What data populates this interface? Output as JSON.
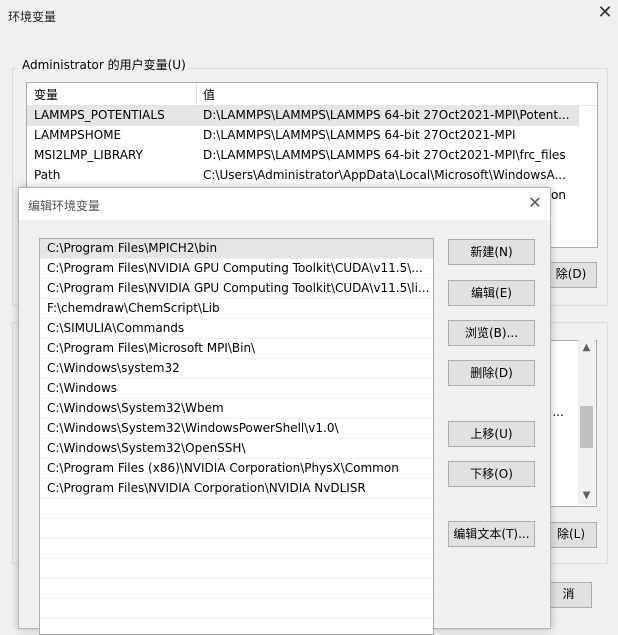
{
  "env_window": {
    "title": "环境变量",
    "user_group_label": "Administrator 的用户变量(U)",
    "columns": {
      "variable": "变量",
      "value": "值"
    },
    "user_vars": [
      {
        "name": "LAMMPS_POTENTIALS",
        "value": "D:\\LAMMPS\\LAMMPS\\LAMMPS 64-bit 27Oct2021-MPI\\Potent..."
      },
      {
        "name": "LAMMPSHOME",
        "value": "D:\\LAMMPS\\LAMMPS\\LAMMPS 64-bit 27Oct2021-MPI"
      },
      {
        "name": "MSI2LMP_LIBRARY",
        "value": "D:\\LAMMPS\\LAMMPS\\LAMMPS 64-bit 27Oct2021-MPI\\frc_files"
      },
      {
        "name": "Path",
        "value": "C:\\Users\\Administrator\\AppData\\Local\\Microsoft\\WindowsA..."
      },
      {
        "name": "",
        "value": "on"
      }
    ],
    "user_delete_fragment": "除(D)",
    "sys_row_fragment": "J ...",
    "sys_delete_fragment": "除(L)",
    "cancel_fragment": "消"
  },
  "edit_dialog": {
    "title": "编辑环境变量",
    "paths": [
      "C:\\Program Files\\MPICH2\\bin",
      "C:\\Program Files\\NVIDIA GPU Computing Toolkit\\CUDA\\v11.5\\...",
      "C:\\Program Files\\NVIDIA GPU Computing Toolkit\\CUDA\\v11.5\\li...",
      "F:\\chemdraw\\ChemScript\\Lib",
      "C:\\SIMULIA\\Commands",
      "C:\\Program Files\\Microsoft MPI\\Bin\\",
      "C:\\Windows\\system32",
      "C:\\Windows",
      "C:\\Windows\\System32\\Wbem",
      "C:\\Windows\\System32\\WindowsPowerShell\\v1.0\\",
      "C:\\Windows\\System32\\OpenSSH\\",
      "C:\\Program Files (x86)\\NVIDIA Corporation\\PhysX\\Common",
      "C:\\Program Files\\NVIDIA Corporation\\NVIDIA NvDLISR"
    ],
    "buttons": {
      "new": "新建(N)",
      "edit": "编辑(E)",
      "browse": "浏览(B)...",
      "delete": "删除(D)",
      "move_up": "上移(U)",
      "move_down": "下移(O)",
      "edit_text": "编辑文本(T)..."
    }
  }
}
